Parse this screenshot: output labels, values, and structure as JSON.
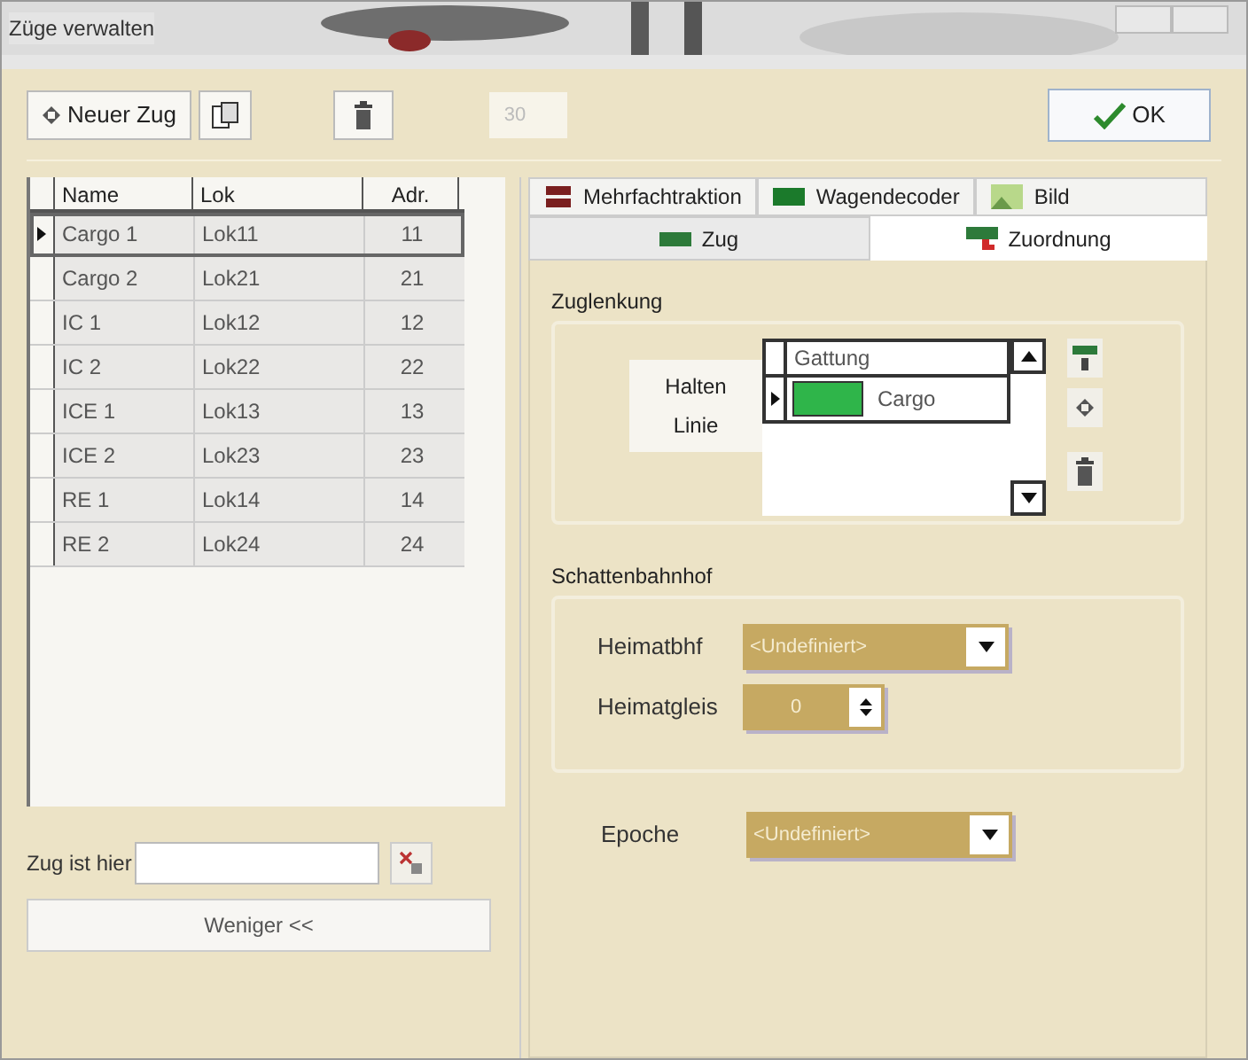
{
  "window": {
    "title": "Züge verwalten"
  },
  "toolbar": {
    "new_button": {
      "label": "Neuer Zug"
    },
    "number_field": {
      "value": "30",
      "disabled": true
    },
    "ok_button": {
      "label": "OK"
    }
  },
  "table": {
    "columns": [
      "Name",
      "Lok",
      "Adr."
    ],
    "rows": [
      {
        "name": "Cargo 1",
        "lok": "Lok11",
        "adr": "11",
        "selected": true
      },
      {
        "name": "Cargo 2",
        "lok": "Lok21",
        "adr": "21",
        "selected": false
      },
      {
        "name": "IC 1",
        "lok": "Lok12",
        "adr": "12",
        "selected": false
      },
      {
        "name": "IC 2",
        "lok": "Lok22",
        "adr": "22",
        "selected": false
      },
      {
        "name": "ICE 1",
        "lok": "Lok13",
        "adr": "13",
        "selected": false
      },
      {
        "name": "ICE 2",
        "lok": "Lok23",
        "adr": "23",
        "selected": false
      },
      {
        "name": "RE 1",
        "lok": "Lok14",
        "adr": "14",
        "selected": false
      },
      {
        "name": "RE 2",
        "lok": "Lok24",
        "adr": "24",
        "selected": false
      }
    ]
  },
  "location": {
    "label": "Zug ist hier"
  },
  "less_button": {
    "label": "Weniger <<"
  },
  "tabs_top": [
    {
      "label": "Mehrfachtraktion",
      "selected": false
    },
    {
      "label": "Wagendecoder",
      "selected": false
    },
    {
      "label": "Bild",
      "selected": false
    }
  ],
  "tabs_bottom": [
    {
      "label": "Zug",
      "selected": false
    },
    {
      "label": "Zuordnung",
      "selected": true
    }
  ],
  "zuglenkung": {
    "title": "Zuglenkung",
    "labels": [
      "Halten",
      "Linie"
    ],
    "list_header": "Gattung",
    "items": [
      {
        "name": "Cargo",
        "color": "#2fb54a",
        "selected": true
      }
    ]
  },
  "schattenbahnhof": {
    "title": "Schattenbahnhof",
    "heimatbhf_label": "Heimatbhf",
    "heimatbhf_value": "<Undefiniert>",
    "heimatgleis_label": "Heimatgleis",
    "heimatgleis_value": "0"
  },
  "epoche": {
    "label": "Epoche",
    "value": "<Undefiniert>"
  }
}
